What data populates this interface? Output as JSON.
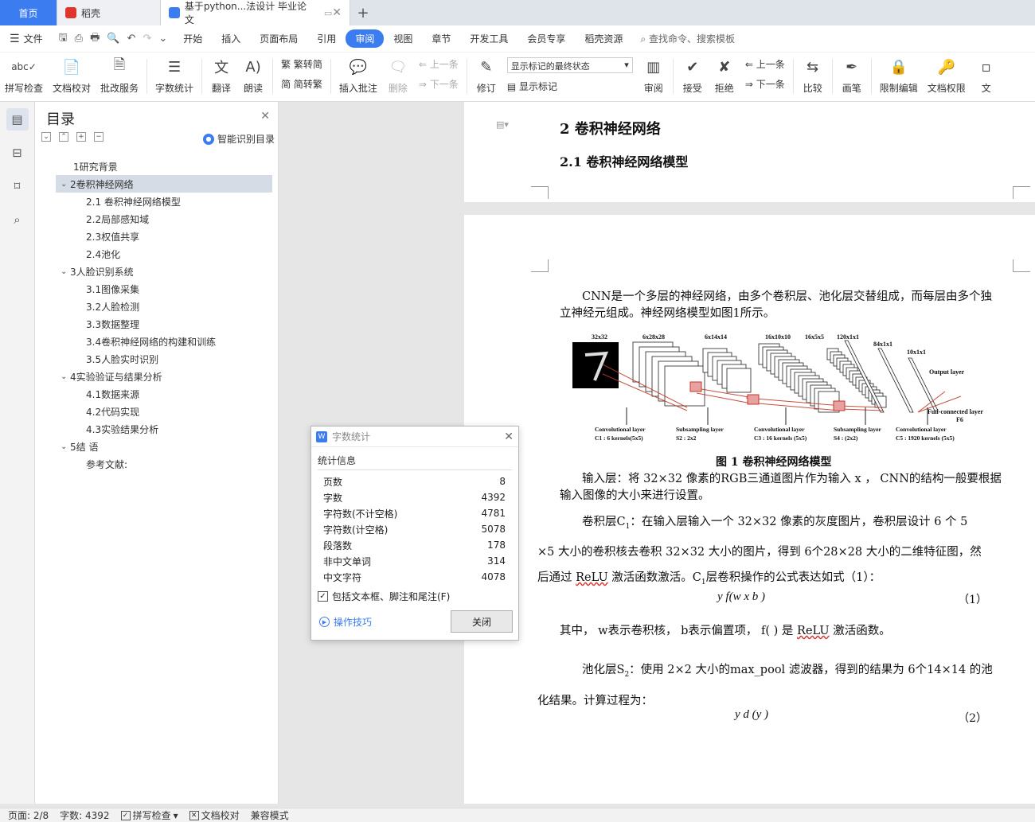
{
  "tabs": [
    {
      "label": "首页"
    },
    {
      "label": "稻壳"
    },
    {
      "label": "基于python...法设计 毕业论文"
    }
  ],
  "menubar": {
    "file": "文件",
    "items": [
      "开始",
      "插入",
      "页面布局",
      "引用",
      "审阅",
      "视图",
      "章节",
      "开发工具",
      "会员专享",
      "稻壳资源"
    ],
    "active": "审阅",
    "search": "查找命令、搜索模板"
  },
  "ribbon": {
    "spell": "拼写检查",
    "proof": "文档校对",
    "revise_service": "批改服务",
    "word_count": "字数统计",
    "translate": "翻译",
    "read_aloud": "朗读",
    "to_trad": "繁转简",
    "to_simp": "简转繁",
    "insert_comment": "插入批注",
    "delete": "删除",
    "prev_comment": "上一条",
    "next_comment": "下一条",
    "track": "修订",
    "markup_select": "显示标记的最终状态",
    "show_markup": "显示标记",
    "review_pane": "审阅",
    "accept": "接受",
    "reject": "拒绝",
    "prev_change": "上一条",
    "next_change": "下一条",
    "compare": "比较",
    "ink": "画笔",
    "restrict": "限制编辑",
    "permission": "文档权限",
    "more": "文"
  },
  "toc": {
    "title": "目录",
    "smart": "智能识别目录",
    "items": [
      {
        "label": "1研究背景",
        "level": 1,
        "chev": ""
      },
      {
        "label": "2卷积神经网络",
        "level": 1,
        "chev": "v",
        "selected": true
      },
      {
        "label": "2.1 卷积神经网络模型",
        "level": 2
      },
      {
        "label": "2.2局部感知域",
        "level": 2
      },
      {
        "label": "2.3权值共享",
        "level": 2
      },
      {
        "label": "2.4池化",
        "level": 2
      },
      {
        "label": "3人脸识别系统",
        "level": 1,
        "chev": "v"
      },
      {
        "label": "3.1图像采集",
        "level": 2
      },
      {
        "label": "3.2人脸检测",
        "level": 2
      },
      {
        "label": "3.3数据整理",
        "level": 2
      },
      {
        "label": "3.4卷积神经网络的构建和训练",
        "level": 2
      },
      {
        "label": "3.5人脸实时识别",
        "level": 2
      },
      {
        "label": "4实验验证与结果分析",
        "level": 1,
        "chev": "v"
      },
      {
        "label": "4.1数据来源",
        "level": 2
      },
      {
        "label": "4.2代码实现",
        "level": 2
      },
      {
        "label": "4.3实验结果分析",
        "level": 2
      },
      {
        "label": "5结 语",
        "level": 1,
        "chev": "v"
      },
      {
        "label": "参考文献:",
        "level": 2
      }
    ]
  },
  "doc": {
    "h1": "2  卷积神经网络",
    "h2": "2.1 卷积神经网络模型",
    "p1": "CNN是一个多层的神经网络，由多个卷积层、池化层交替组成，而每层由多个独立神经元组成。神经网络模型如图1所示。",
    "fig_caption": "图 1 卷积神经网络模型",
    "p2": "输入层：将 32×32 像素的RGB三通道图片作为输入 x ， CNN的结构一般要根据输入图像的大小来进行设置。",
    "p3a": "卷积层C",
    "p3b": "：在输入层输入一个 32×32 像素的灰度图片，卷积层设计 6 个 5",
    "p3c": "×5 大小的卷积核去卷积 32×32 大小的图片，得到 6个28×28 大小的二维特征图，然",
    "p3d_pre": "后通过 ",
    "relu": "ReLU",
    "p3d_post": " 激活函数激活。C",
    "p3d_tail": "层卷积操作的公式表达如式（1）：",
    "eq1": "y    f(w x    b )",
    "eq1_no": "（1）",
    "p4_a": "其中，  w",
    "p4_b": "表示卷积核，  b",
    "p4_c": "表示偏置项，  f(   ) 是 ",
    "p4_d": " 激活函数。",
    "p5a": "池化层S",
    "p5b": "：使用 2×2 大小的max_pool 滤波器，得到的结果为 6个14×14 的池",
    "p5c": "化结果。计算过程为：",
    "eq2": "y     d (y )",
    "eq2_no": "（2）",
    "sub1": "1",
    "sub2": "2"
  },
  "figure": {
    "labels_top": [
      "32x32",
      "6x28x28",
      "6x14x14",
      "16x10x10",
      "16x5x5",
      "120x1x1",
      "84x1x1",
      "10x1x1"
    ],
    "output_layer": "Output layer",
    "fc_layer": "Full-connected layer",
    "f6": "F6",
    "bottom": [
      {
        "a": "Convolutional layer",
        "b": "C1 : 6 kernels(5x5)"
      },
      {
        "a": "Subsampling layer",
        "b": "S2 : 2x2"
      },
      {
        "a": "Convolutional layer",
        "b": "C3 : 16 kernels (5x5)"
      },
      {
        "a": "Subsampling layer",
        "b": "S4 : (2x2)"
      },
      {
        "a": "Convolutional layer",
        "b": "C5 : 1920 kernels (5x5)"
      }
    ]
  },
  "dialog": {
    "title": "字数统计",
    "section": "统计信息",
    "stats": [
      {
        "label": "页数",
        "value": "8"
      },
      {
        "label": "字数",
        "value": "4392"
      },
      {
        "label": "字符数(不计空格)",
        "value": "4781"
      },
      {
        "label": "字符数(计空格)",
        "value": "5078"
      },
      {
        "label": "段落数",
        "value": "178"
      },
      {
        "label": "非中文单词",
        "value": "314"
      },
      {
        "label": "中文字符",
        "value": "4078"
      }
    ],
    "checkbox": "包括文本框、脚注和尾注(F)",
    "tip": "操作技巧",
    "close": "关闭"
  },
  "status": {
    "page": "页面: 2/8",
    "words": "字数: 4392",
    "spell": "拼写检查",
    "proof": "文档校对",
    "compat": "兼容模式"
  },
  "colors": {
    "accent": "#3b7cf0",
    "selected": "#d5dce6",
    "fig_red": "#c0392b"
  }
}
